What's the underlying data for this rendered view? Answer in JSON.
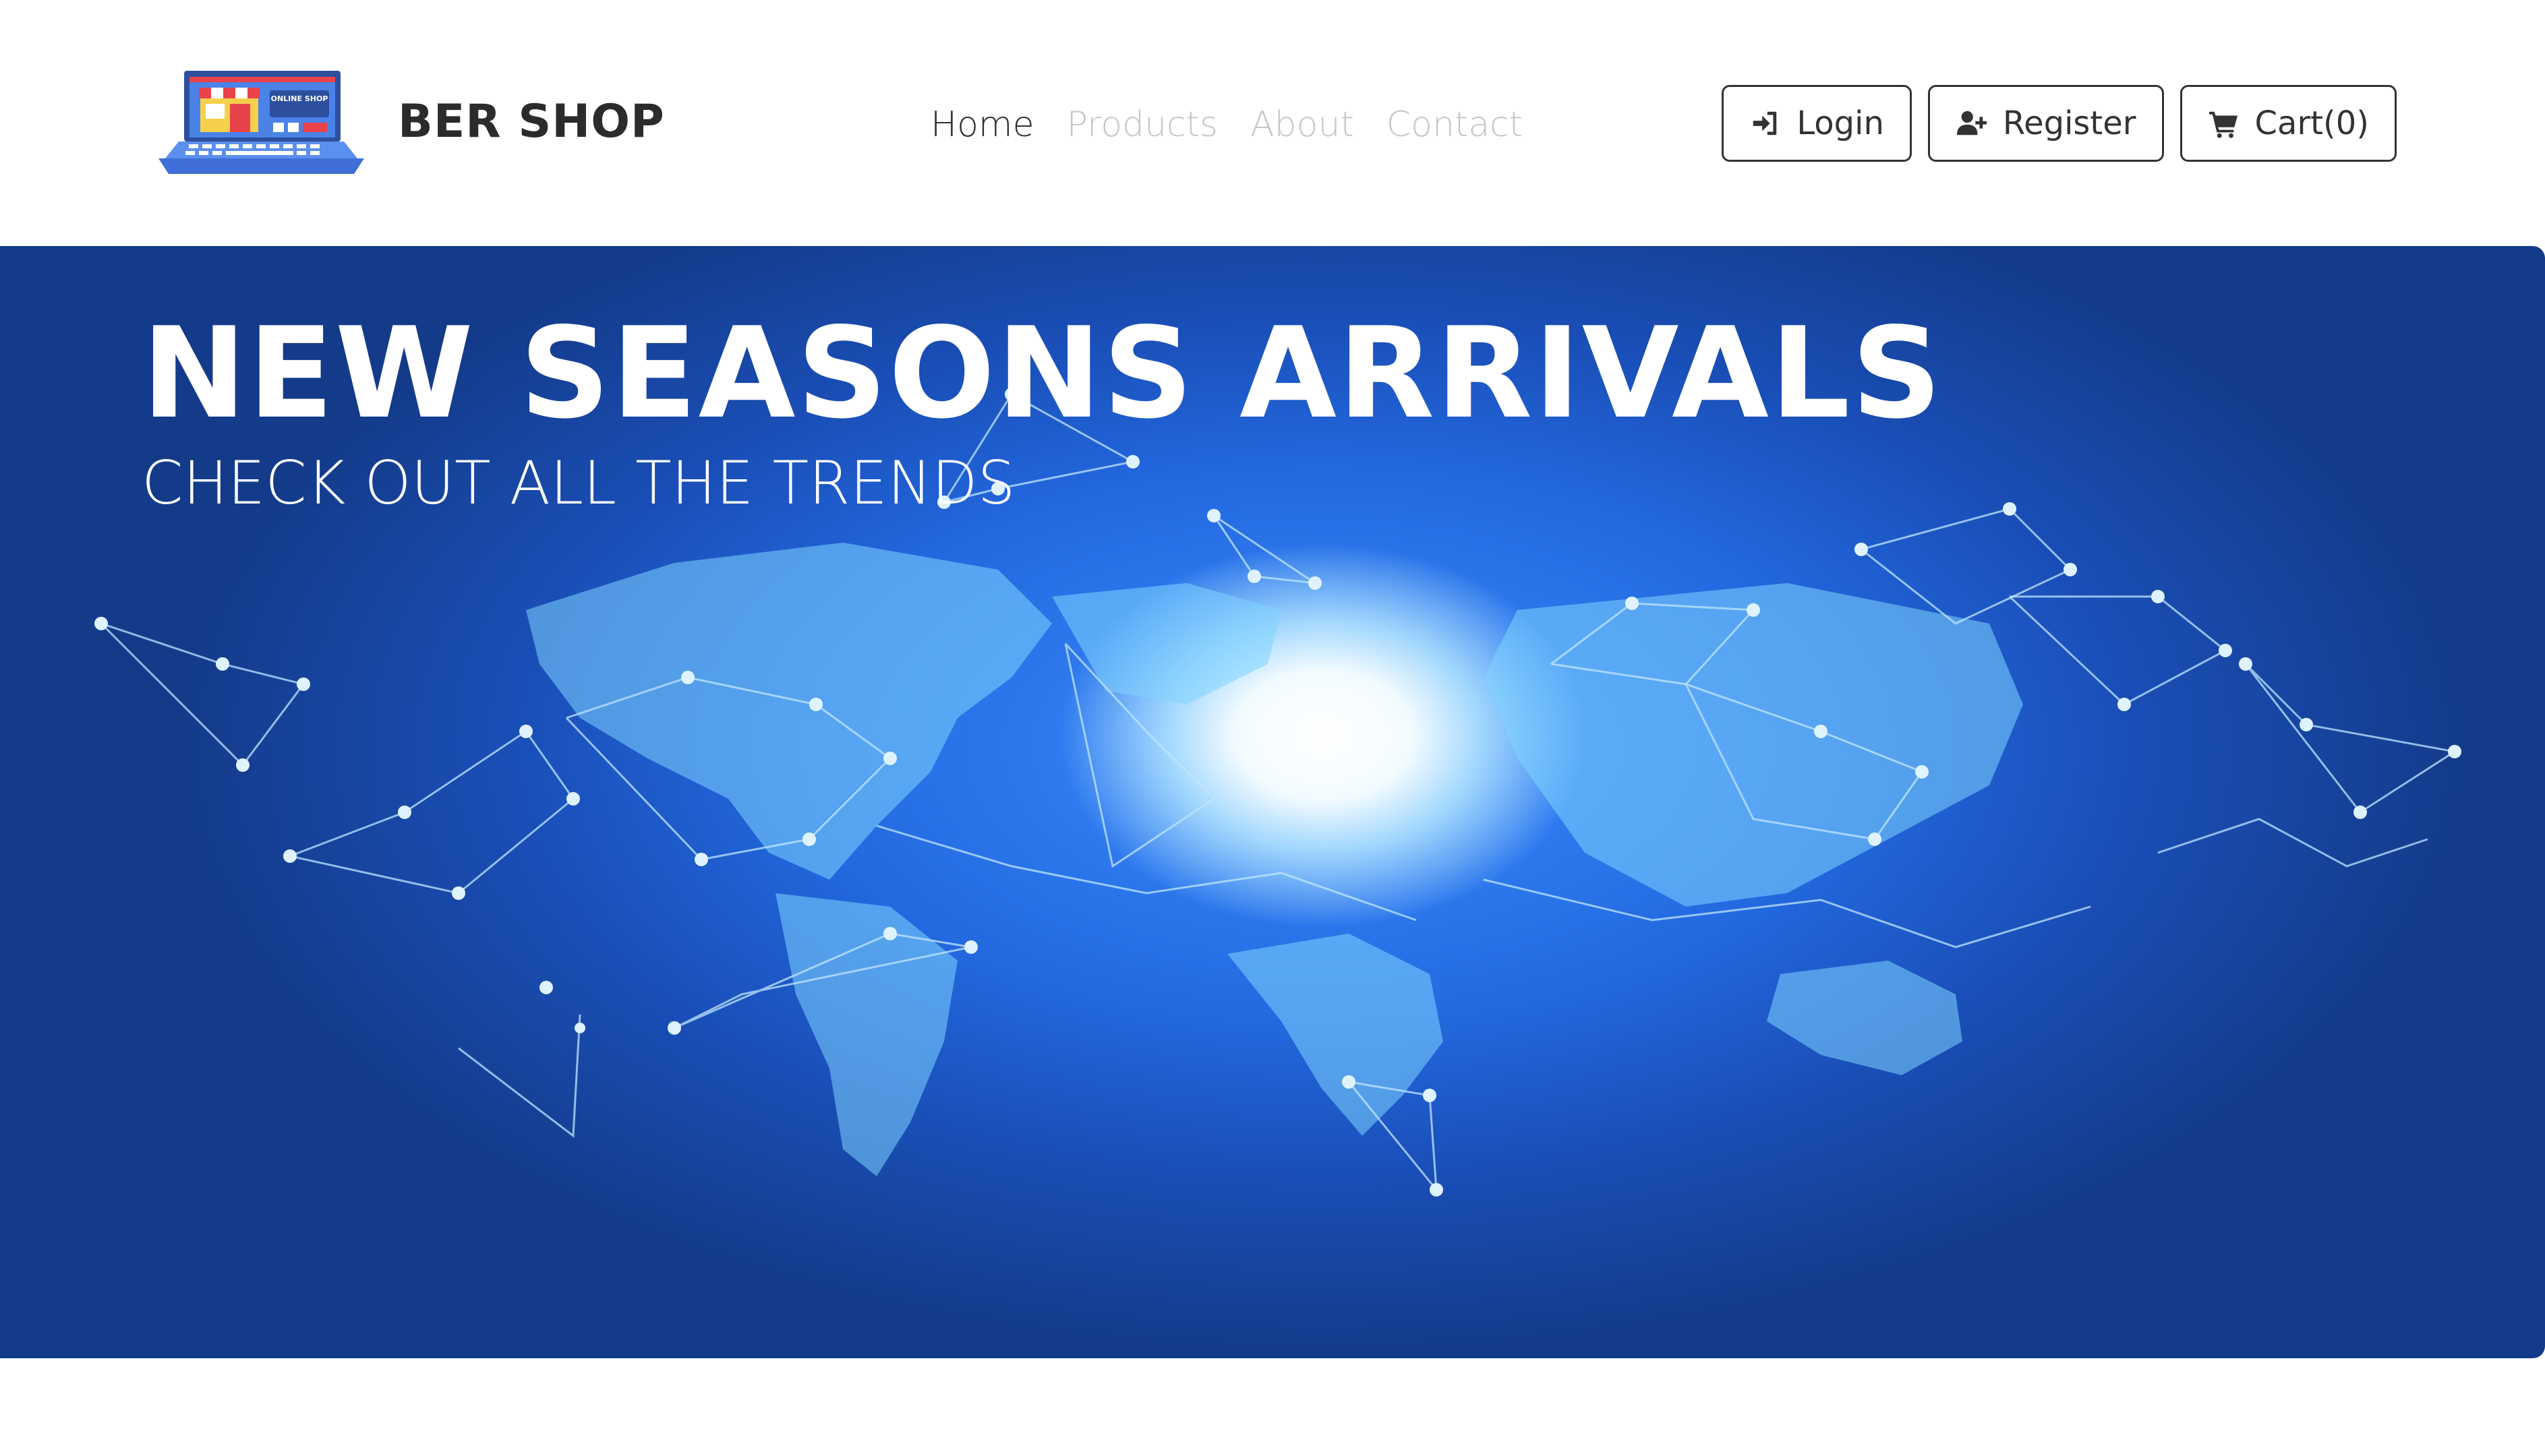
{
  "brand": {
    "name": "BER SHOP",
    "logo_icon": "online-shop-laptop-icon",
    "logo_text": "ONLINE SHOP"
  },
  "nav": {
    "links": [
      {
        "label": "Home",
        "active": true
      },
      {
        "label": "Products",
        "active": false
      },
      {
        "label": "About",
        "active": false
      },
      {
        "label": "Contact",
        "active": false
      }
    ]
  },
  "buttons": {
    "login": {
      "label": "Login",
      "icon": "sign-in-icon"
    },
    "register": {
      "label": "Register",
      "icon": "user-plus-icon"
    },
    "cart": {
      "label": "Cart(0)",
      "icon": "shopping-cart-icon"
    }
  },
  "hero": {
    "title": "NEW SEASONS ARRIVALS",
    "subtitle": "CHECK OUT ALL THE TRENDS",
    "background": "world-network-map",
    "colors": {
      "deep": "#143b8a",
      "mid": "#2369e0",
      "glow": "#ffffff"
    }
  }
}
